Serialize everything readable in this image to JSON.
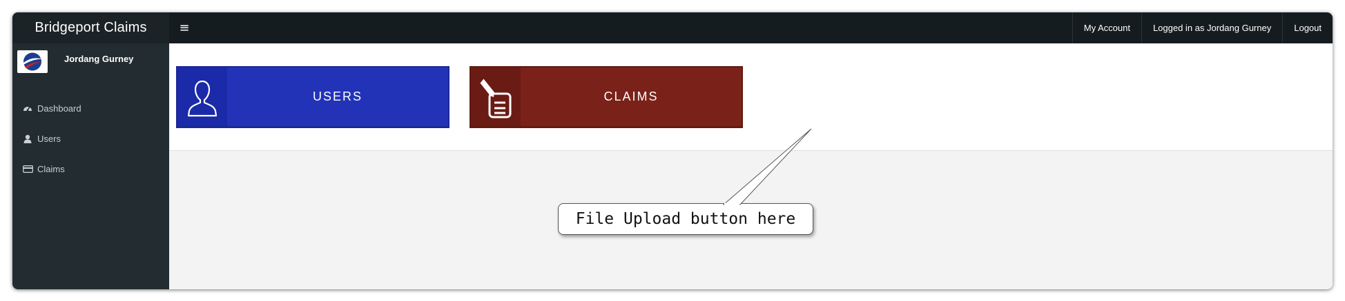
{
  "header": {
    "brand": "Bridgeport Claims",
    "menu_toggle_icon": "hamburger-icon",
    "nav": {
      "my_account": "My Account",
      "logged_in": "Logged in as Jordang Gurney",
      "logout": "Logout"
    }
  },
  "sidebar": {
    "user_name": "Jordang Gurney",
    "items": [
      {
        "label": "Dashboard",
        "icon": "dashboard-icon"
      },
      {
        "label": "Users",
        "icon": "user-icon"
      },
      {
        "label": "Claims",
        "icon": "credit-card-icon"
      }
    ]
  },
  "tiles": {
    "users": {
      "label": "USERS",
      "icon": "user-outline-icon",
      "color": "#2233b8"
    },
    "claims": {
      "label": "CLAIMS",
      "icon": "pen-clipboard-icon",
      "color": "#7a2219"
    }
  },
  "annotation": {
    "text": "File Upload button here"
  }
}
